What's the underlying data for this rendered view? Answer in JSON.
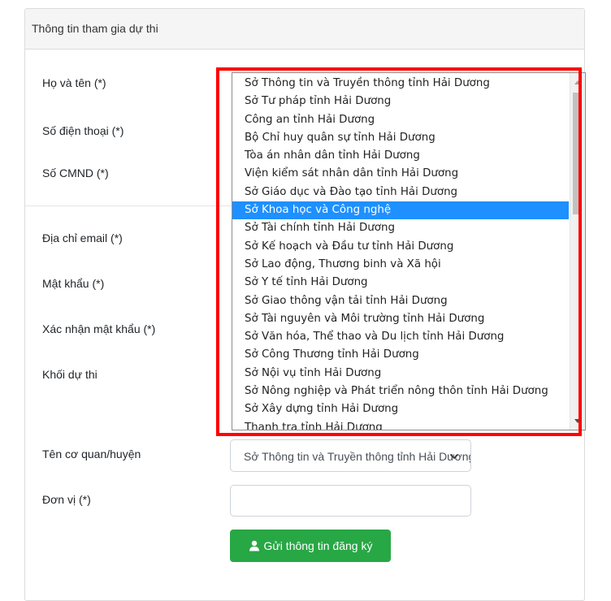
{
  "form": {
    "header": "Thông tin tham gia dự thi",
    "labels": {
      "full_name": "Họ và tên (*)",
      "phone": "Số điện thoại (*)",
      "id_number": "Số CMND (*)",
      "email": "Địa chỉ email (*)",
      "password": "Mật khẩu (*)",
      "confirm_password": "Xác nhận mật khẩu (*)",
      "exam_group": "Khối dự thi",
      "agency": "Tên cơ quan/huyện",
      "unit": "Đơn vị (*)"
    },
    "agency_select": {
      "value": "Sở Thông tin và Truyền thông tỉnh Hải Dương"
    },
    "unit_input": {
      "value": ""
    },
    "submit_label": "Gửi thông tin đăng ký"
  },
  "dropdown": {
    "selected_index": 7,
    "options": [
      "Sở Thông tin và Truyền thông tỉnh Hải Dương",
      "Sở Tư pháp tỉnh Hải Dương",
      "Công an tỉnh Hải Dương",
      "Bộ Chỉ huy quân sự tỉnh Hải Dương",
      "Tòa án nhân dân tỉnh Hải Dương",
      "Viện kiểm sát nhân dân tỉnh Hải Dương",
      "Sở Giáo dục và Đào tạo tỉnh Hải Dương",
      "Sở Khoa học và Công nghệ",
      "Sở Tài chính tỉnh Hải Dương",
      "Sở Kế hoạch và Đầu tư tỉnh Hải Dương",
      "Sở Lao động, Thương binh và Xã hội",
      "Sở Y tế tỉnh Hải Dương",
      "Sở Giao thông vận tải tỉnh Hải Dương",
      "Sở Tài nguyên và Môi trường tỉnh Hải Dương",
      "Sở Văn hóa, Thể thao và Du lịch tỉnh Hải Dương",
      "Sở Công Thương tỉnh Hải Dương",
      "Sở Nội vụ tỉnh Hải Dương",
      "Sở Nông nghiệp và Phát triển nông thôn tỉnh Hải Dương",
      "Sở Xây dựng tỉnh Hải Dương",
      "Thanh tra tỉnh Hải Dương"
    ]
  },
  "colors": {
    "submit": "#28a745",
    "selected_option": "#1e90ff",
    "annotation": "#ff0000"
  },
  "icons": {
    "submit": "user-icon",
    "select": "chevron-down-icon"
  }
}
